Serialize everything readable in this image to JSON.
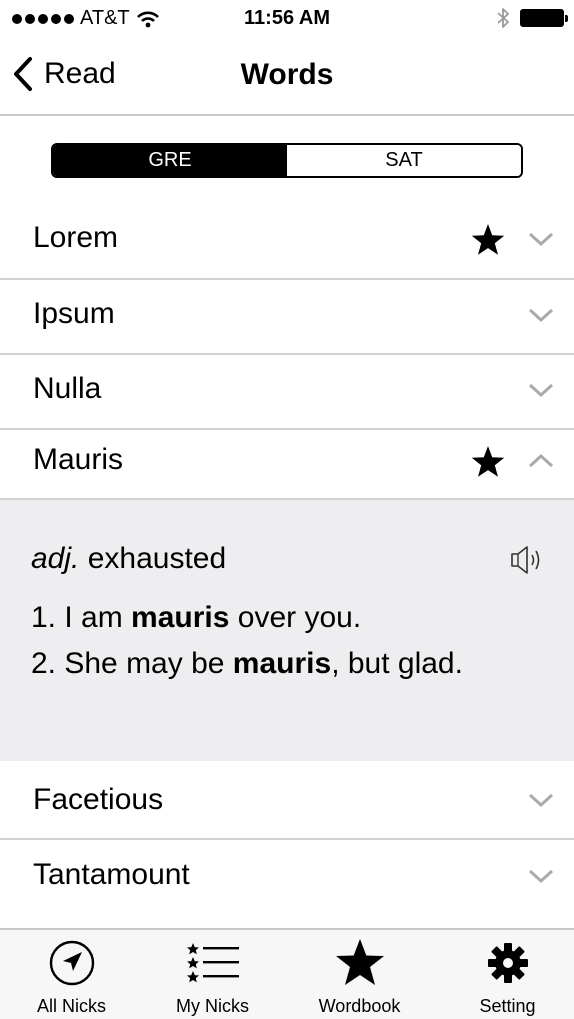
{
  "status_bar": {
    "carrier": "AT&T",
    "time": "11:56 AM"
  },
  "nav": {
    "back_label": "Read",
    "title": "Words"
  },
  "segments": {
    "gre": "GRE",
    "sat": "SAT",
    "selected": "GRE"
  },
  "words": [
    {
      "word": "Lorem",
      "starred": true,
      "expanded": false
    },
    {
      "word": "Ipsum",
      "starred": false,
      "expanded": false
    },
    {
      "word": "Nulla",
      "starred": false,
      "expanded": false
    },
    {
      "word": "Mauris",
      "starred": true,
      "expanded": true
    },
    {
      "word": "Facetious",
      "starred": false,
      "expanded": false
    },
    {
      "word": "Tantamount",
      "starred": false,
      "expanded": false
    }
  ],
  "detail": {
    "part_of_speech": "adj.",
    "definition": "exhausted",
    "examples": [
      {
        "prefix": "1. I am ",
        "highlight": "mauris",
        "suffix": " over you."
      },
      {
        "prefix": "2. She may be ",
        "highlight": "mauris",
        "suffix": ", but glad."
      }
    ]
  },
  "tabs": [
    {
      "label": "All Nicks",
      "icon": "compass-icon"
    },
    {
      "label": "My Nicks",
      "icon": "starred-list-icon"
    },
    {
      "label": "Wordbook",
      "icon": "star-icon"
    },
    {
      "label": "Setting",
      "icon": "gear-icon"
    }
  ],
  "colors": {
    "separator": "#d2d2d2",
    "detail_background": "#eeeef1",
    "chevron": "#aaaaaa",
    "tab_bar_background": "#f7f7f7"
  }
}
